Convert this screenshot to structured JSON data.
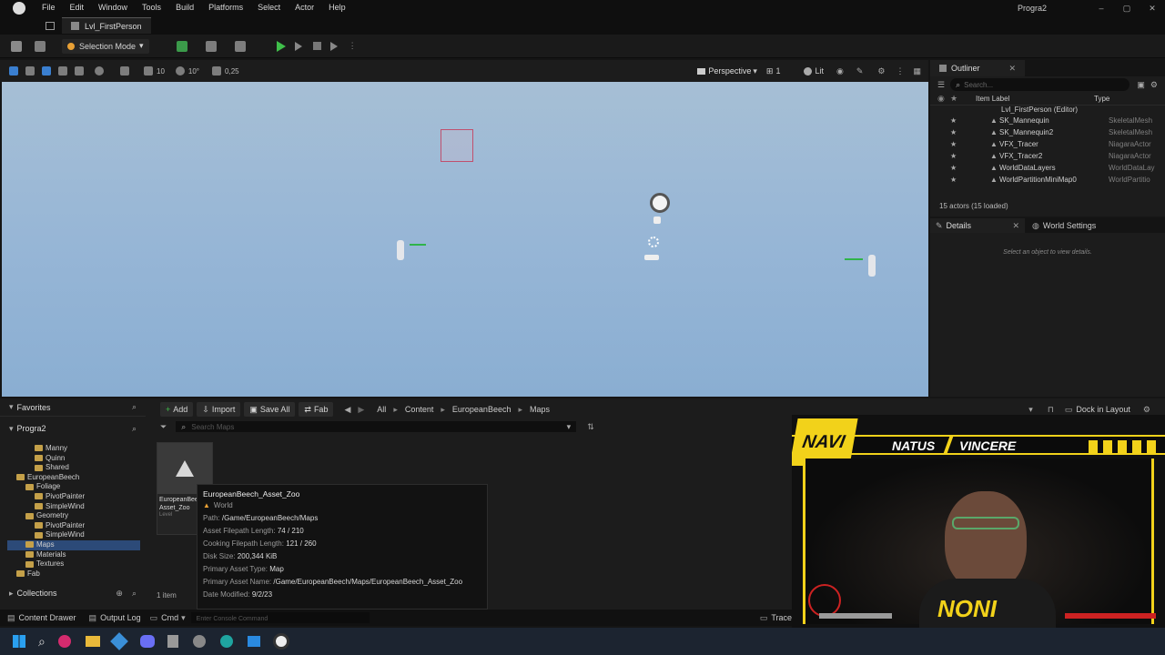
{
  "menu": [
    "File",
    "Edit",
    "Window",
    "Tools",
    "Build",
    "Platforms",
    "Select",
    "Actor",
    "Help"
  ],
  "project_name": "Progra2",
  "level_tab": "Lvl_FirstPerson",
  "toolbar": {
    "mode_label": "Selection Mode"
  },
  "viewport_toolbar": {
    "grid_value": "10",
    "rotate_value": "10°",
    "scale_value": "0,25",
    "perspective_label": "Perspective",
    "camera_speed": "1",
    "lit_label": "Lit"
  },
  "outliner": {
    "title": "Outliner",
    "search_placeholder": "Search...",
    "col_label": "Item Label",
    "col_type": "Type",
    "root": "Lvl_FirstPerson (Editor)",
    "items": [
      {
        "name": "SK_Mannequin",
        "type": "SkeletalMesh"
      },
      {
        "name": "SK_Mannequin2",
        "type": "SkeletalMesh"
      },
      {
        "name": "VFX_Tracer",
        "type": "NiagaraActor"
      },
      {
        "name": "VFX_Tracer2",
        "type": "NiagaraActor"
      },
      {
        "name": "WorldDataLayers",
        "type": "WorldDataLay"
      },
      {
        "name": "WorldPartitionMiniMap0",
        "type": "WorldPartitio"
      }
    ],
    "status": "15 actors (15 loaded)"
  },
  "details": {
    "tab1": "Details",
    "tab2": "World Settings",
    "empty_text": "Select an object to view details."
  },
  "content_browser": {
    "favorites_label": "Favorites",
    "project_root": "Progra2",
    "add_label": "Add",
    "import_label": "Import",
    "save_all_label": "Save All",
    "fab_label": "Fab",
    "breadcrumb": [
      "All",
      "Content",
      "EuropeanBeech",
      "Maps"
    ],
    "dock_label": "Dock in Layout",
    "search_placeholder": "Search Maps",
    "tree": [
      {
        "label": "Manny",
        "indent": 3
      },
      {
        "label": "Quinn",
        "indent": 3
      },
      {
        "label": "Shared",
        "indent": 3
      },
      {
        "label": "EuropeanBeech",
        "indent": 1
      },
      {
        "label": "Foliage",
        "indent": 2
      },
      {
        "label": "PivotPainter",
        "indent": 3
      },
      {
        "label": "SimpleWind",
        "indent": 3
      },
      {
        "label": "Geometry",
        "indent": 2
      },
      {
        "label": "PivotPainter",
        "indent": 3
      },
      {
        "label": "SimpleWind",
        "indent": 3
      },
      {
        "label": "Maps",
        "indent": 2
      },
      {
        "label": "Materials",
        "indent": 2
      },
      {
        "label": "Textures",
        "indent": 2
      },
      {
        "label": "Fab",
        "indent": 1
      }
    ],
    "asset_name": "EuropeanBeech_Asset_Zoo",
    "asset_type": "Level",
    "item_count": "1 item",
    "collections_label": "Collections"
  },
  "tooltip": {
    "title": "EuropeanBeech_Asset_Zoo",
    "subtitle": "World",
    "rows": [
      {
        "k": "Path:",
        "v": "/Game/EuropeanBeech/Maps"
      },
      {
        "k": "Asset Filepath Length:",
        "v": "74 / 210"
      },
      {
        "k": "Cooking Filepath Length:",
        "v": "121 / 260"
      },
      {
        "k": "Disk Size:",
        "v": "200,344 KiB"
      },
      {
        "k": "Primary Asset Type:",
        "v": "Map"
      },
      {
        "k": "Primary Asset Name:",
        "v": "/Game/EuropeanBeech/Maps/EuropeanBeech_Asset_Zoo"
      },
      {
        "k": "Date Modified:",
        "v": "9/2/23"
      }
    ]
  },
  "statusbar": {
    "content_drawer": "Content Drawer",
    "output_log": "Output Log",
    "cmd": "Cmd",
    "console_placeholder": "Enter Console Command",
    "trace": "Trace"
  },
  "overlay": {
    "team_left": "NATUS",
    "team_right": "VINCERE",
    "streamer": "NONI",
    "logo": "NAVI"
  },
  "colors": {
    "viewport_sky": "#9bb8d6",
    "accent_green": "#2fb34a",
    "folder": "#c4a049",
    "navi_yellow": "#f2d21a"
  }
}
